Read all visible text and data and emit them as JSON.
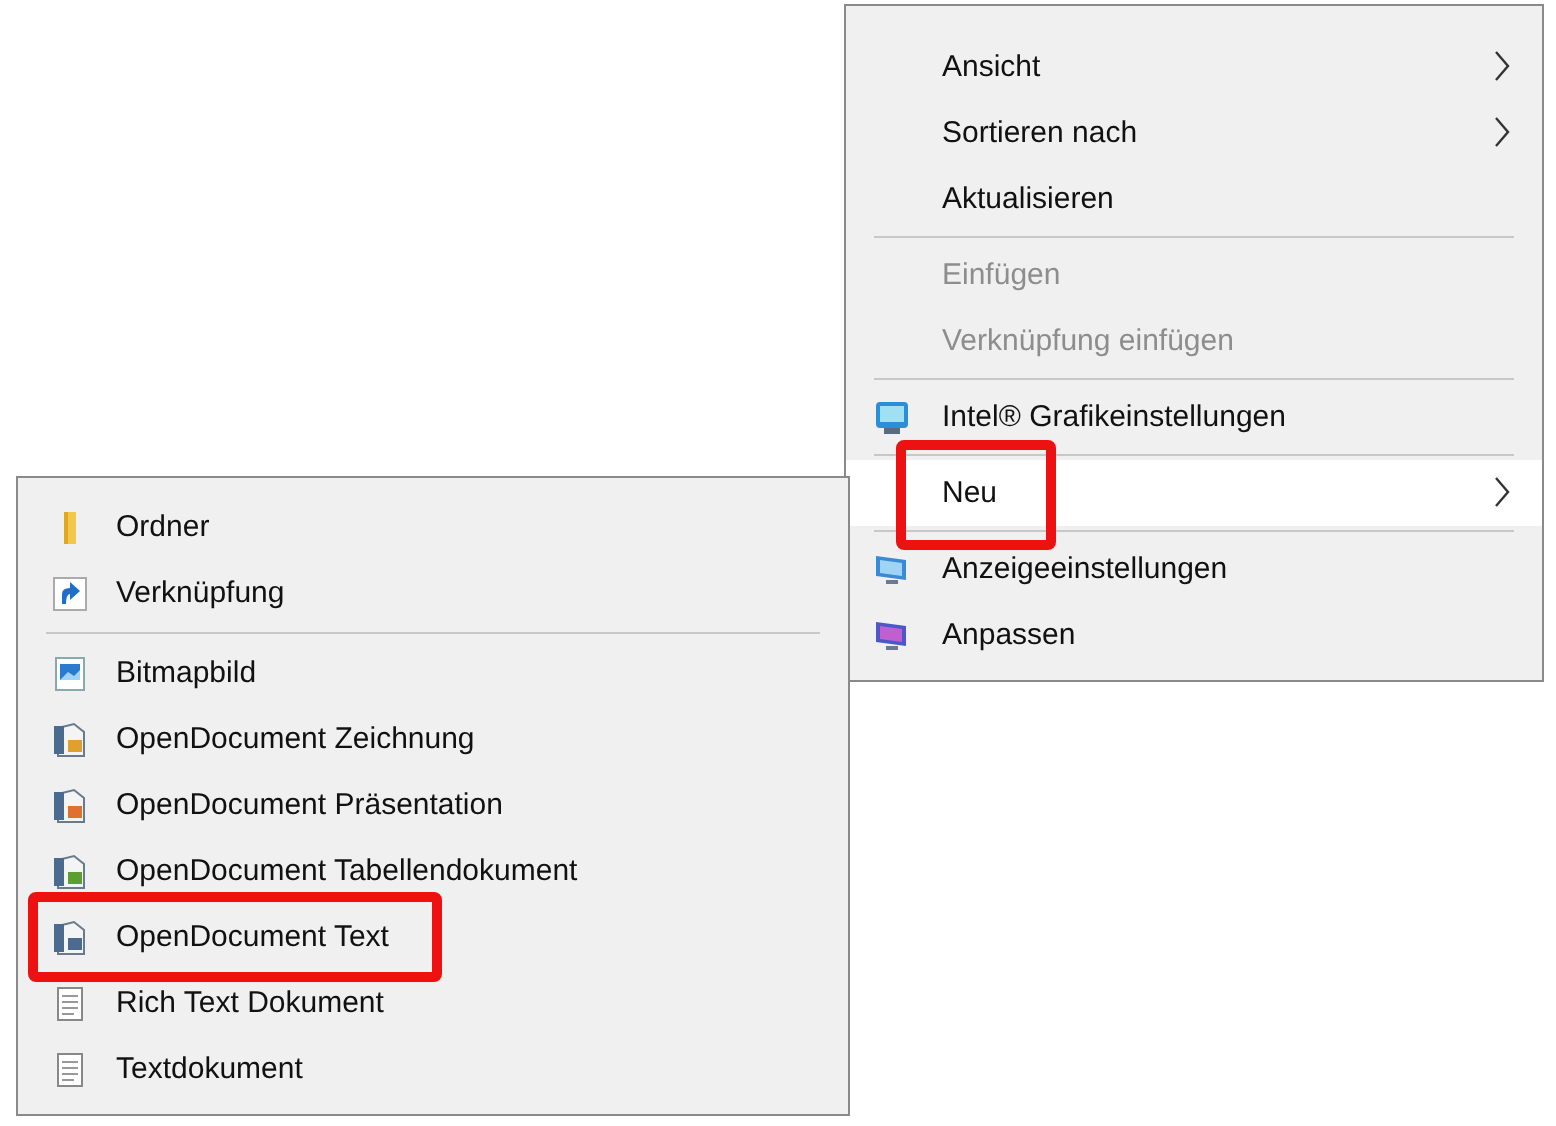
{
  "context_menu": {
    "items": [
      {
        "kind": "item",
        "label": "Ansicht",
        "submenu": true,
        "disabled": false,
        "selected": false,
        "highlighted": false
      },
      {
        "kind": "item",
        "label": "Sortieren nach",
        "submenu": true,
        "disabled": false,
        "selected": false,
        "highlighted": false
      },
      {
        "kind": "item",
        "label": "Aktualisieren",
        "submenu": false,
        "disabled": false,
        "selected": false,
        "highlighted": false
      },
      {
        "kind": "separator"
      },
      {
        "kind": "item",
        "label": "Einfügen",
        "submenu": false,
        "disabled": true,
        "selected": false,
        "highlighted": false
      },
      {
        "kind": "item",
        "label": "Verknüpfung einfügen",
        "submenu": false,
        "disabled": true,
        "selected": false,
        "highlighted": false
      },
      {
        "kind": "separator"
      },
      {
        "kind": "graphics",
        "label": "Intel® Grafikeinstellungen",
        "submenu": false,
        "disabled": false,
        "selected": false,
        "highlighted": false
      },
      {
        "kind": "separator"
      },
      {
        "kind": "item",
        "label": "Neu",
        "submenu": true,
        "disabled": false,
        "selected": true,
        "highlighted": true
      },
      {
        "kind": "separator"
      },
      {
        "kind": "display",
        "label": "Anzeigeeinstellungen",
        "submenu": false,
        "disabled": false,
        "selected": false,
        "highlighted": false
      },
      {
        "kind": "personalize",
        "label": "Anpassen",
        "submenu": false,
        "disabled": false,
        "selected": false,
        "highlighted": false
      }
    ]
  },
  "new_submenu": {
    "items": [
      {
        "kind": "folder",
        "label": "Ordner",
        "highlighted": false
      },
      {
        "kind": "shortcut",
        "label": "Verknüpfung",
        "highlighted": false
      },
      {
        "kind": "separator"
      },
      {
        "kind": "bitmap",
        "label": "Bitmapbild",
        "highlighted": false
      },
      {
        "kind": "odg",
        "label": "OpenDocument Zeichnung",
        "highlighted": false
      },
      {
        "kind": "odp",
        "label": "OpenDocument Präsentation",
        "highlighted": false
      },
      {
        "kind": "ods",
        "label": "OpenDocument Tabellendokument",
        "highlighted": false
      },
      {
        "kind": "odt",
        "label": "OpenDocument Text",
        "highlighted": true
      },
      {
        "kind": "rtf",
        "label": "Rich Text Dokument",
        "highlighted": false
      },
      {
        "kind": "txt",
        "label": "Textdokument",
        "highlighted": false
      }
    ]
  }
}
